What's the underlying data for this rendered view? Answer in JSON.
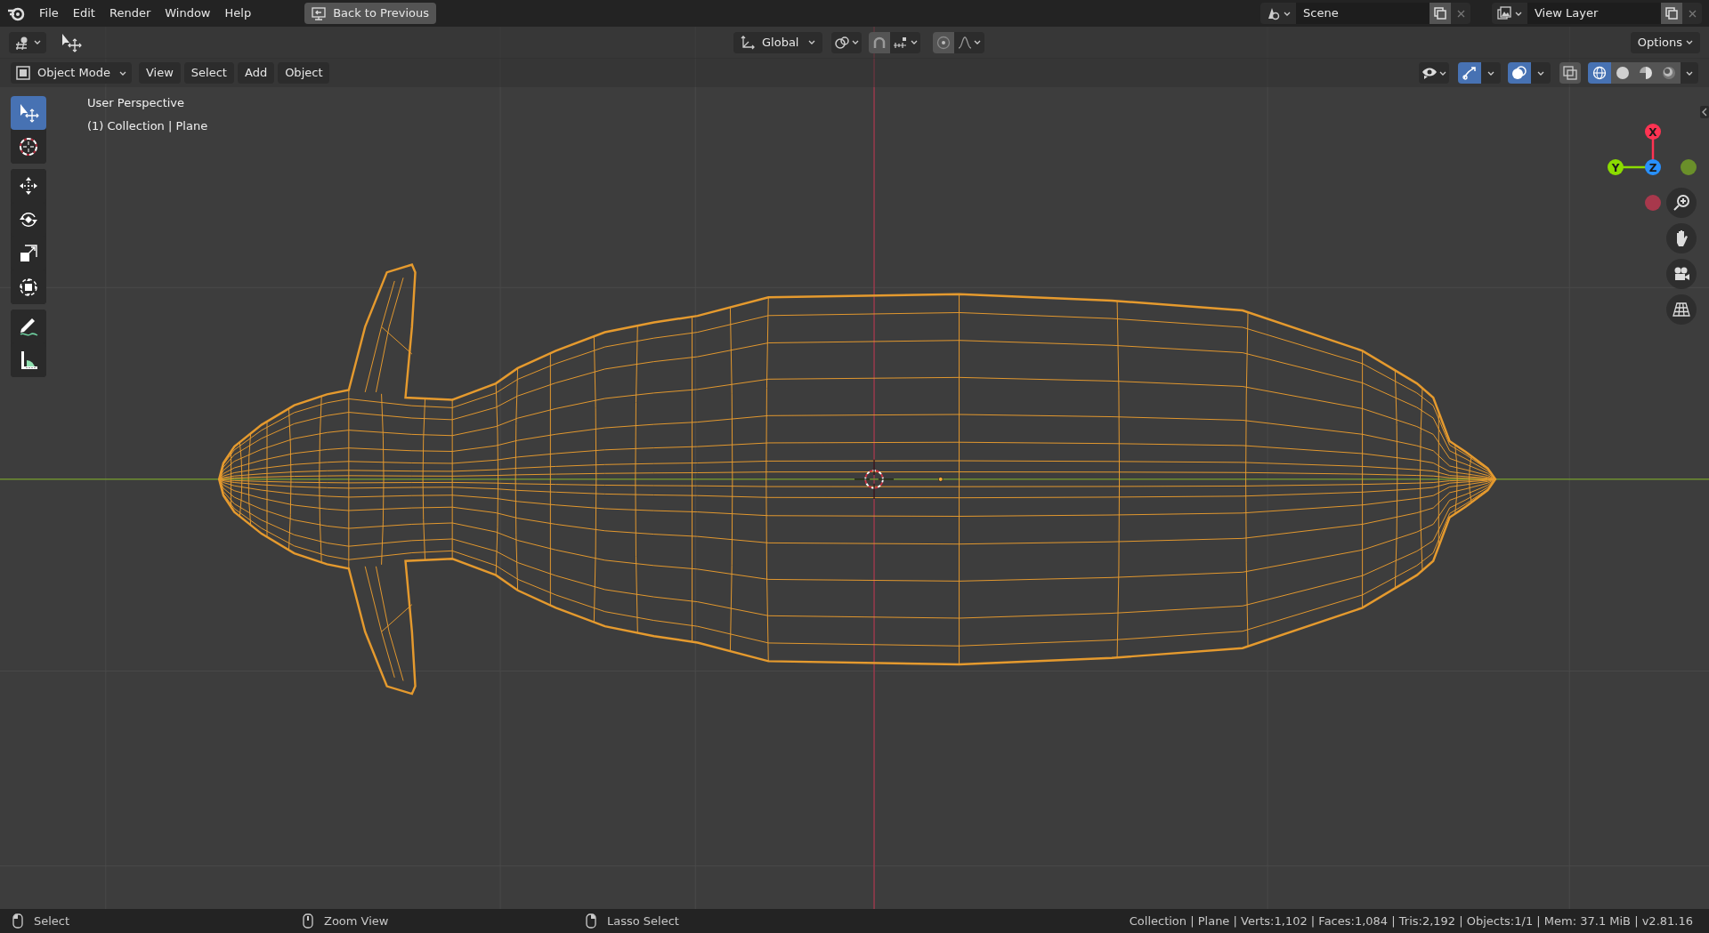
{
  "menu": [
    {
      "label": "File"
    },
    {
      "label": "Edit"
    },
    {
      "label": "Render"
    },
    {
      "label": "Window"
    },
    {
      "label": "Help"
    }
  ],
  "back_button": {
    "label": "Back to Previous"
  },
  "scene": {
    "value": "Scene"
  },
  "view_layer": {
    "value": "View Layer"
  },
  "tool_header": {
    "orientation": "Global",
    "snap": {
      "on": false
    },
    "proportional": {
      "on": false
    },
    "options": "Options"
  },
  "viewport_header": {
    "mode": "Object Mode",
    "menus": [
      {
        "label": "View"
      },
      {
        "label": "Select"
      },
      {
        "label": "Add"
      },
      {
        "label": "Object"
      }
    ],
    "gizmos": {
      "on": true
    },
    "overlays": {
      "on": true
    },
    "xray": {
      "on": false
    },
    "shading": [
      {
        "kind": "wireframe",
        "selected": true
      },
      {
        "kind": "solid",
        "selected": false
      },
      {
        "kind": "material",
        "selected": false
      },
      {
        "kind": "rendered",
        "selected": false
      }
    ]
  },
  "toolbar": [
    [
      {
        "kind": "select",
        "selected": true
      },
      {
        "kind": "cursor",
        "selected": false
      }
    ],
    [
      {
        "kind": "move",
        "selected": false
      },
      {
        "kind": "rotate",
        "selected": false
      },
      {
        "kind": "scale",
        "selected": false
      },
      {
        "kind": "transform",
        "selected": false
      }
    ],
    [
      {
        "kind": "annotate",
        "selected": false
      },
      {
        "kind": "measure",
        "selected": false
      }
    ]
  ],
  "viewport_text": {
    "view_name": "User Perspective",
    "object_info": "(1) Collection | Plane"
  },
  "gizmo": {
    "axes": [
      {
        "label": "X",
        "color": "#ff3352"
      },
      {
        "label": "Y",
        "color": "#8bdc00"
      },
      {
        "label": "Z",
        "color": "#2890ff"
      }
    ]
  },
  "status_bar": {
    "hints": [
      {
        "kind": "mouse_left",
        "label": "Select"
      },
      {
        "kind": "mouse_middle",
        "label": "Zoom View"
      },
      {
        "kind": "mouse_right",
        "label": "Lasso Select"
      }
    ],
    "stats": "Collection | Plane | Verts:1,102 | Faces:1,084 | Tris:2,192 | Objects:1/1 | Mem: 37.1 MiB | v2.81.16"
  }
}
